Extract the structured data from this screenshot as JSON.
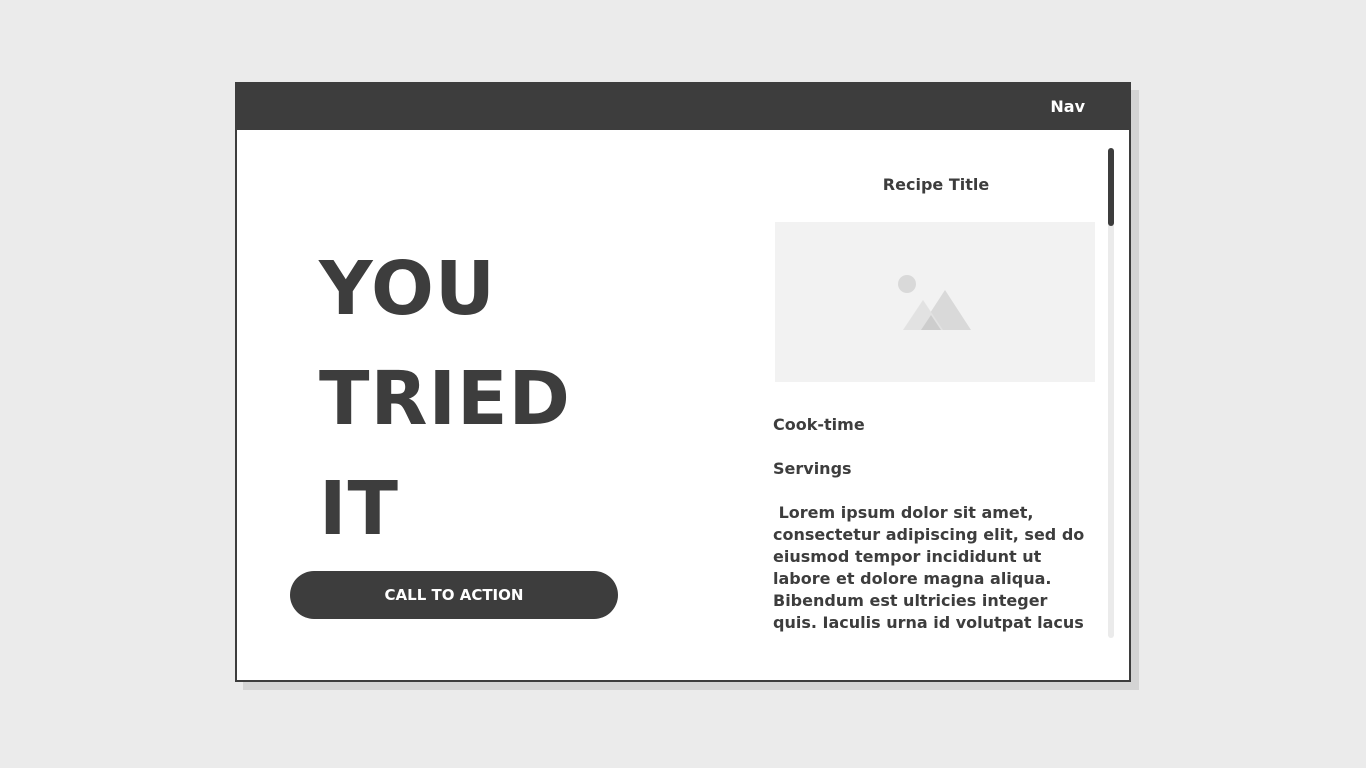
{
  "nav": {
    "label": "Nav"
  },
  "hero": {
    "lines": [
      "YOU",
      "TRIED",
      "IT"
    ],
    "cta_label": "CALL TO ACTION"
  },
  "recipe": {
    "title": "Recipe Title",
    "image_icon": "image-placeholder-icon",
    "cook_time_label": "Cook-time",
    "servings_label": "Servings",
    "body": " Lorem ipsum dolor sit amet, consectetur adipiscing elit, sed do eiusmod tempor incididunt ut labore et dolore magna aliqua. Bibendum est ultricies integer quis. Iaculis urna id volutpat lacus laoreet. Mauris vitae"
  },
  "colors": {
    "dark": "#3d3d3d",
    "background": "#ebebeb",
    "placeholder": "#f2f2f2"
  }
}
